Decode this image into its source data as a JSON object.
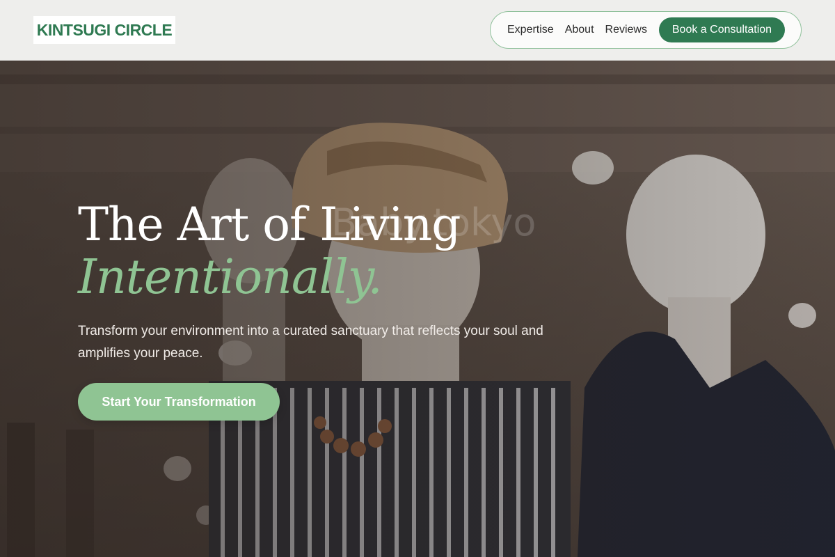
{
  "header": {
    "logo": "KINTSUGI CIRCLE",
    "nav": {
      "links": [
        "Expertise",
        "About",
        "Reviews"
      ],
      "cta": "Book a Consultation"
    }
  },
  "hero": {
    "title": "The Art of Living",
    "title_accent": "Intentionally.",
    "watermark": "Baby.tokyo",
    "subtitle": "Transform your environment into a curated sanctuary that reflects your soul and amplifies your peace.",
    "cta": "Start Your Transformation"
  },
  "colors": {
    "brand_green": "#2f7a52",
    "accent_sage": "#8fc493",
    "header_bg": "#eeeeec"
  }
}
